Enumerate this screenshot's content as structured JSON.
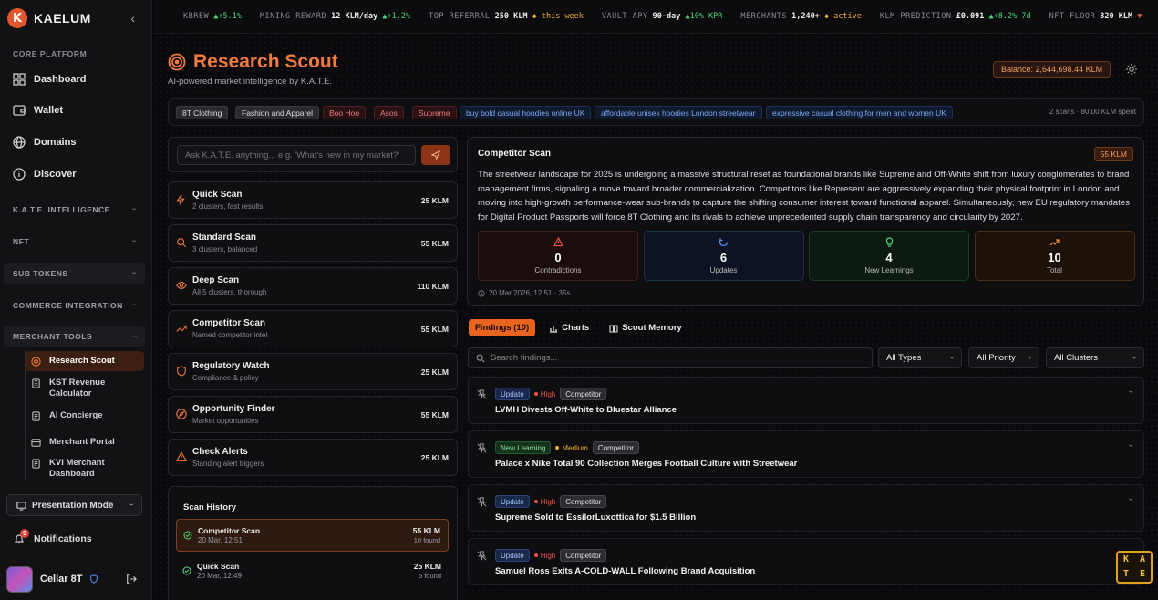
{
  "sidebar": {
    "brand": "KAELUM",
    "brand_mark": "K",
    "collapse_glyph": "‹",
    "section_core": "CORE PLATFORM",
    "core_items": [
      {
        "label": "Dashboard",
        "icon": "grid-icon"
      },
      {
        "label": "Wallet",
        "icon": "wallet-icon"
      },
      {
        "label": "Domains",
        "icon": "globe-icon"
      },
      {
        "label": "Discover",
        "icon": "info-circle-icon"
      }
    ],
    "groups": [
      "K.A.T.E. INTELLIGENCE",
      "NFT",
      "SUB TOKENS",
      "COMMERCE INTEGRATION",
      "MERCHANT TOOLS"
    ],
    "merchant_items": [
      {
        "label": "Research Scout",
        "active": true
      },
      {
        "label": "KST Revenue Calculator"
      },
      {
        "label": "AI Concierge"
      },
      {
        "label": "Merchant Portal"
      },
      {
        "label": "KVI Merchant Dashboard"
      }
    ],
    "presentation": "Presentation Mode",
    "notifications": "Notifications",
    "notif_count": "9",
    "user": "Cellar 8T"
  },
  "ticker": [
    {
      "label": "KBREW",
      "value": "",
      "change": "▲+5.1%",
      "cls": "tk-up"
    },
    {
      "label": "MINING REWARD",
      "value": "12 KLM/day",
      "change": "▲+1.2%",
      "cls": "tk-up"
    },
    {
      "label": "TOP REFERRAL",
      "value": "250 KLM",
      "change": "◆ this week",
      "cls": "tk-gold"
    },
    {
      "label": "VAULT APY",
      "value": "90-day",
      "change": "▲10% KPR",
      "cls": "tk-up"
    },
    {
      "label": "MERCHANTS",
      "value": "1,240+",
      "change": "◆ active",
      "cls": "tk-gold"
    },
    {
      "label": "KLM PREDICTION",
      "value": "£0.091",
      "change": "▲+8.2% 7d",
      "cls": "tk-up"
    },
    {
      "label": "NFT FLOOR",
      "value": "320 KLM",
      "change": "▼",
      "cls": "tk-dn"
    }
  ],
  "header": {
    "title": "Research Scout",
    "subtitle": "AI-powered market intelligence by K.A.T.E.",
    "balance": "Balance: 2,644,698.44 KLM"
  },
  "tags": [
    {
      "label": "8T Clothing",
      "style": "neutral"
    },
    {
      "label": "Fashion and Apparel",
      "style": "neutral"
    },
    {
      "label": "Boo Hoo",
      "style": "red"
    },
    {
      "label": "Asos",
      "style": "red"
    },
    {
      "label": "Supreme",
      "style": "red"
    },
    {
      "label": "buy bold casual hoodies online UK",
      "style": "blue"
    },
    {
      "label": "affordable unisex hoodies London streetwear",
      "style": "blue"
    },
    {
      "label": "expressive casual clothing for men and women UK",
      "style": "blue"
    }
  ],
  "tags_meta": "2 scans · 80.00 KLM spent",
  "ask": {
    "placeholder": "Ask K.A.T.E. anything... e.g. 'What's new in my market?'"
  },
  "scans": [
    {
      "name": "Quick Scan",
      "desc": "2 clusters, fast results",
      "cost": "25 KLM",
      "icon": "bolt-icon"
    },
    {
      "name": "Standard Scan",
      "desc": "3 clusters, balanced",
      "cost": "55 KLM",
      "icon": "search-icon"
    },
    {
      "name": "Deep Scan",
      "desc": "All 5 clusters, thorough",
      "cost": "110 KLM",
      "icon": "eye-icon"
    },
    {
      "name": "Competitor Scan",
      "desc": "Named competitor intel",
      "cost": "55 KLM",
      "icon": "trend-up-icon"
    },
    {
      "name": "Regulatory Watch",
      "desc": "Compliance & policy",
      "cost": "25 KLM",
      "icon": "shield-icon"
    },
    {
      "name": "Opportunity Finder",
      "desc": "Market opportunities",
      "cost": "55 KLM",
      "icon": "compass-icon"
    },
    {
      "name": "Check Alerts",
      "desc": "Standing alert triggers",
      "cost": "25 KLM",
      "icon": "alert-icon"
    }
  ],
  "history": {
    "title": "Scan History",
    "items": [
      {
        "name": "Competitor Scan",
        "date": "20 Mar, 12:51",
        "cost": "55 KLM",
        "found": "10 found",
        "active": true
      },
      {
        "name": "Quick Scan",
        "date": "20 Mar, 12:49",
        "cost": "25 KLM",
        "found": "5 found"
      }
    ]
  },
  "competitor": {
    "title": "Competitor Scan",
    "badge": "55 KLM",
    "summary": "The streetwear landscape for 2025 is undergoing a massive structural reset as foundational brands like Supreme and Off-White shift from luxury conglomerates to brand management firms, signaling a move toward broader commercialization. Competitors like Represent are aggressively expanding their physical footprint in London and moving into high-growth performance-wear sub-brands to capture the shifting consumer interest toward functional apparel. Simultaneously, new EU regulatory mandates for Digital Product Passports will force 8T Clothing and its rivals to achieve unprecedented supply chain transparency and circularity by 2027.",
    "stats": [
      {
        "value": "0",
        "label": "Contradictions",
        "color": "#e5533d",
        "icon": "warning-icon"
      },
      {
        "value": "6",
        "label": "Updates",
        "color": "#5b8ff0",
        "icon": "refresh-icon"
      },
      {
        "value": "4",
        "label": "New Learnings",
        "color": "#4cd37a",
        "icon": "bulb-icon"
      },
      {
        "value": "10",
        "label": "Total",
        "color": "#f08a3f",
        "icon": "trend-up-icon"
      }
    ],
    "date": "20 Mar 2026, 12:51 · 35s"
  },
  "tabs": [
    {
      "label": "Findings (10)",
      "active": true
    },
    {
      "label": "Charts",
      "icon": "bar-chart-icon"
    },
    {
      "label": "Scout Memory",
      "icon": "book-icon"
    }
  ],
  "search": {
    "placeholder": "Search findings..."
  },
  "filters": [
    "All Types",
    "All Priority",
    "All Clusters"
  ],
  "findings": [
    {
      "type": "Update",
      "type_cls": "upd",
      "priority": "High",
      "prio_color": "#f0504a",
      "cat": "Competitor",
      "title": "LVMH Divests Off-White to Bluestar Alliance"
    },
    {
      "type": "New Learning",
      "type_cls": "nl",
      "priority": "Medium",
      "prio_color": "#f0b030",
      "cat": "Competitor",
      "title": "Palace x Nike Total 90 Collection Merges Football Culture with Streetwear"
    },
    {
      "type": "Update",
      "type_cls": "upd",
      "priority": "High",
      "prio_color": "#f0504a",
      "cat": "Competitor",
      "title": "Supreme Sold to EssilorLuxottica for $1.5 Billion"
    },
    {
      "type": "Update",
      "type_cls": "upd",
      "priority": "High",
      "prio_color": "#f0504a",
      "cat": "Competitor",
      "title": "Samuel Ross Exits A-COLD-WALL Following Brand Acquisition"
    }
  ],
  "kate_badge": [
    "K",
    "A",
    "T",
    "E"
  ]
}
